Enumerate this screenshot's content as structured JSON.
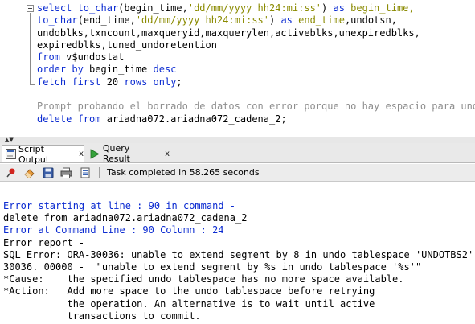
{
  "editor": {
    "lines": [
      [
        {
          "t": "select ",
          "c": "kw"
        },
        {
          "t": "to_char",
          "c": "fn"
        },
        {
          "t": "(begin_time,",
          "c": "plain"
        },
        {
          "t": "'dd/mm/yyyy hh24:mi:ss'",
          "c": "str"
        },
        {
          "t": ") ",
          "c": "plain"
        },
        {
          "t": "as",
          "c": "kw"
        },
        {
          "t": " begin_time,",
          "c": "str"
        }
      ],
      [
        {
          "t": "to_char",
          "c": "fn"
        },
        {
          "t": "(end_time,",
          "c": "plain"
        },
        {
          "t": "'dd/mm/yyyy hh24:mi:ss'",
          "c": "str"
        },
        {
          "t": ") ",
          "c": "plain"
        },
        {
          "t": "as",
          "c": "kw"
        },
        {
          "t": " end_time",
          "c": "str"
        },
        {
          "t": ",undotsn,",
          "c": "plain"
        }
      ],
      [
        {
          "t": "undoblks,txncount,maxqueryid,maxquerylen,activeblks,unexpiredblks,",
          "c": "plain"
        }
      ],
      [
        {
          "t": "expiredblks,tuned_undoretention",
          "c": "plain"
        }
      ],
      [
        {
          "t": "from",
          "c": "kw"
        },
        {
          "t": " v$undostat",
          "c": "plain"
        }
      ],
      [
        {
          "t": "order by",
          "c": "kw"
        },
        {
          "t": " begin_time ",
          "c": "plain"
        },
        {
          "t": "desc",
          "c": "kw"
        }
      ],
      [
        {
          "t": "fetch first",
          "c": "kw"
        },
        {
          "t": " 20 ",
          "c": "plain"
        },
        {
          "t": "rows only",
          "c": "kw"
        },
        {
          "t": ";",
          "c": "plain"
        }
      ],
      [],
      [
        {
          "t": "Prompt probando el borrado de datos con error porque no hay espacio para undo",
          "c": "cm"
        }
      ],
      [
        {
          "t": "delete from",
          "c": "kw"
        },
        {
          "t": " ariadna072.ariadna072_cadena_2;",
          "c": "plain"
        }
      ]
    ]
  },
  "tabs": {
    "script_output": "Script Output",
    "query_result": "Query Result",
    "close": "x"
  },
  "toolbar": {
    "status": "Task completed in 58.265 seconds"
  },
  "output": {
    "lines": [
      {
        "t": "Error starting at line : 90 in command -",
        "c": "err"
      },
      {
        "t": "delete from ariadna072.ariadna072_cadena_2",
        "c": "plain"
      },
      {
        "t": "Error at Command Line : 90 Column : 24",
        "c": "err"
      },
      {
        "t": "Error report -",
        "c": "plain"
      },
      {
        "t": "SQL Error: ORA-30036: unable to extend segment by 8 in undo tablespace 'UNDOTBS2'",
        "c": "plain"
      },
      {
        "t": "30036. 00000 -  \"unable to extend segment by %s in undo tablespace '%s'\"",
        "c": "plain"
      },
      {
        "t": "*Cause:    the specified undo tablespace has no more space available.",
        "c": "plain"
      },
      {
        "t": "*Action:   Add more space to the undo tablespace before retrying",
        "c": "plain"
      },
      {
        "t": "           the operation. An alternative is to wait until active",
        "c": "plain"
      },
      {
        "t": "           transactions to commit.",
        "c": "plain"
      }
    ]
  }
}
